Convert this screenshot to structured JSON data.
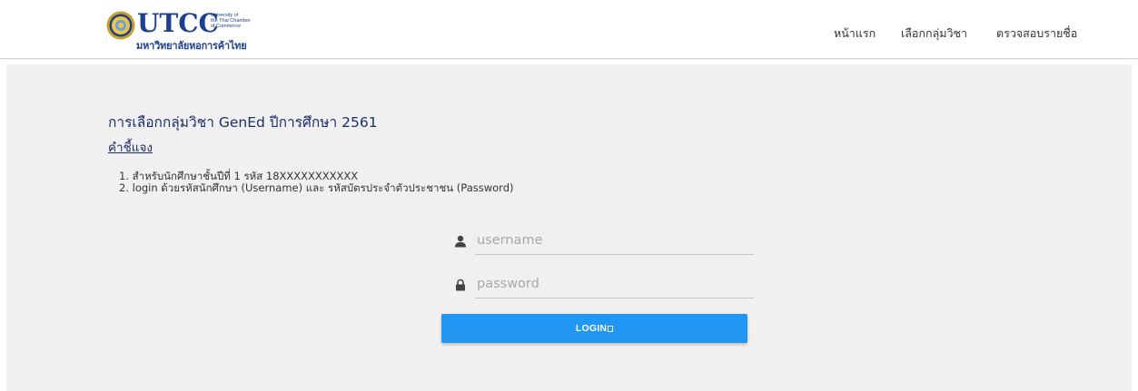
{
  "brand": {
    "name": "UTCC",
    "tagline_lines": [
      "University of",
      "the Thai Chamber",
      "of Commerce"
    ],
    "thai_name": "มหาวิทยาลัยหอการค้าไทย",
    "primary_color": "#1c3f8f",
    "seal_color": "#c9a02a"
  },
  "nav": {
    "items": [
      {
        "label": "หน้าแรก"
      },
      {
        "label": "เลือกกลุ่มวิชา"
      },
      {
        "label": "ตรวจสอบรายชื่อ"
      }
    ]
  },
  "main": {
    "title": "การเลือกกลุ่มวิชา GenEd ปีการศึกษา 2561",
    "explain_link": "คำชี้แจง",
    "instructions": [
      "1. สำหรับนักศึกษาชั้นปีที่ 1 รหัส 18XXXXXXXXXXX",
      "2. login ด้วยรหัสนักศึกษา (Username) และ รหัสบัตรประจำตัวประชาชน (Password)"
    ]
  },
  "login": {
    "username_placeholder": "username",
    "password_placeholder": "password",
    "button_label": "LOGIN",
    "button_color": "#2196f3"
  },
  "icons": {
    "username": "user-icon",
    "password": "lock-icon",
    "login_button_glyph": "unknown-glyph-box"
  }
}
